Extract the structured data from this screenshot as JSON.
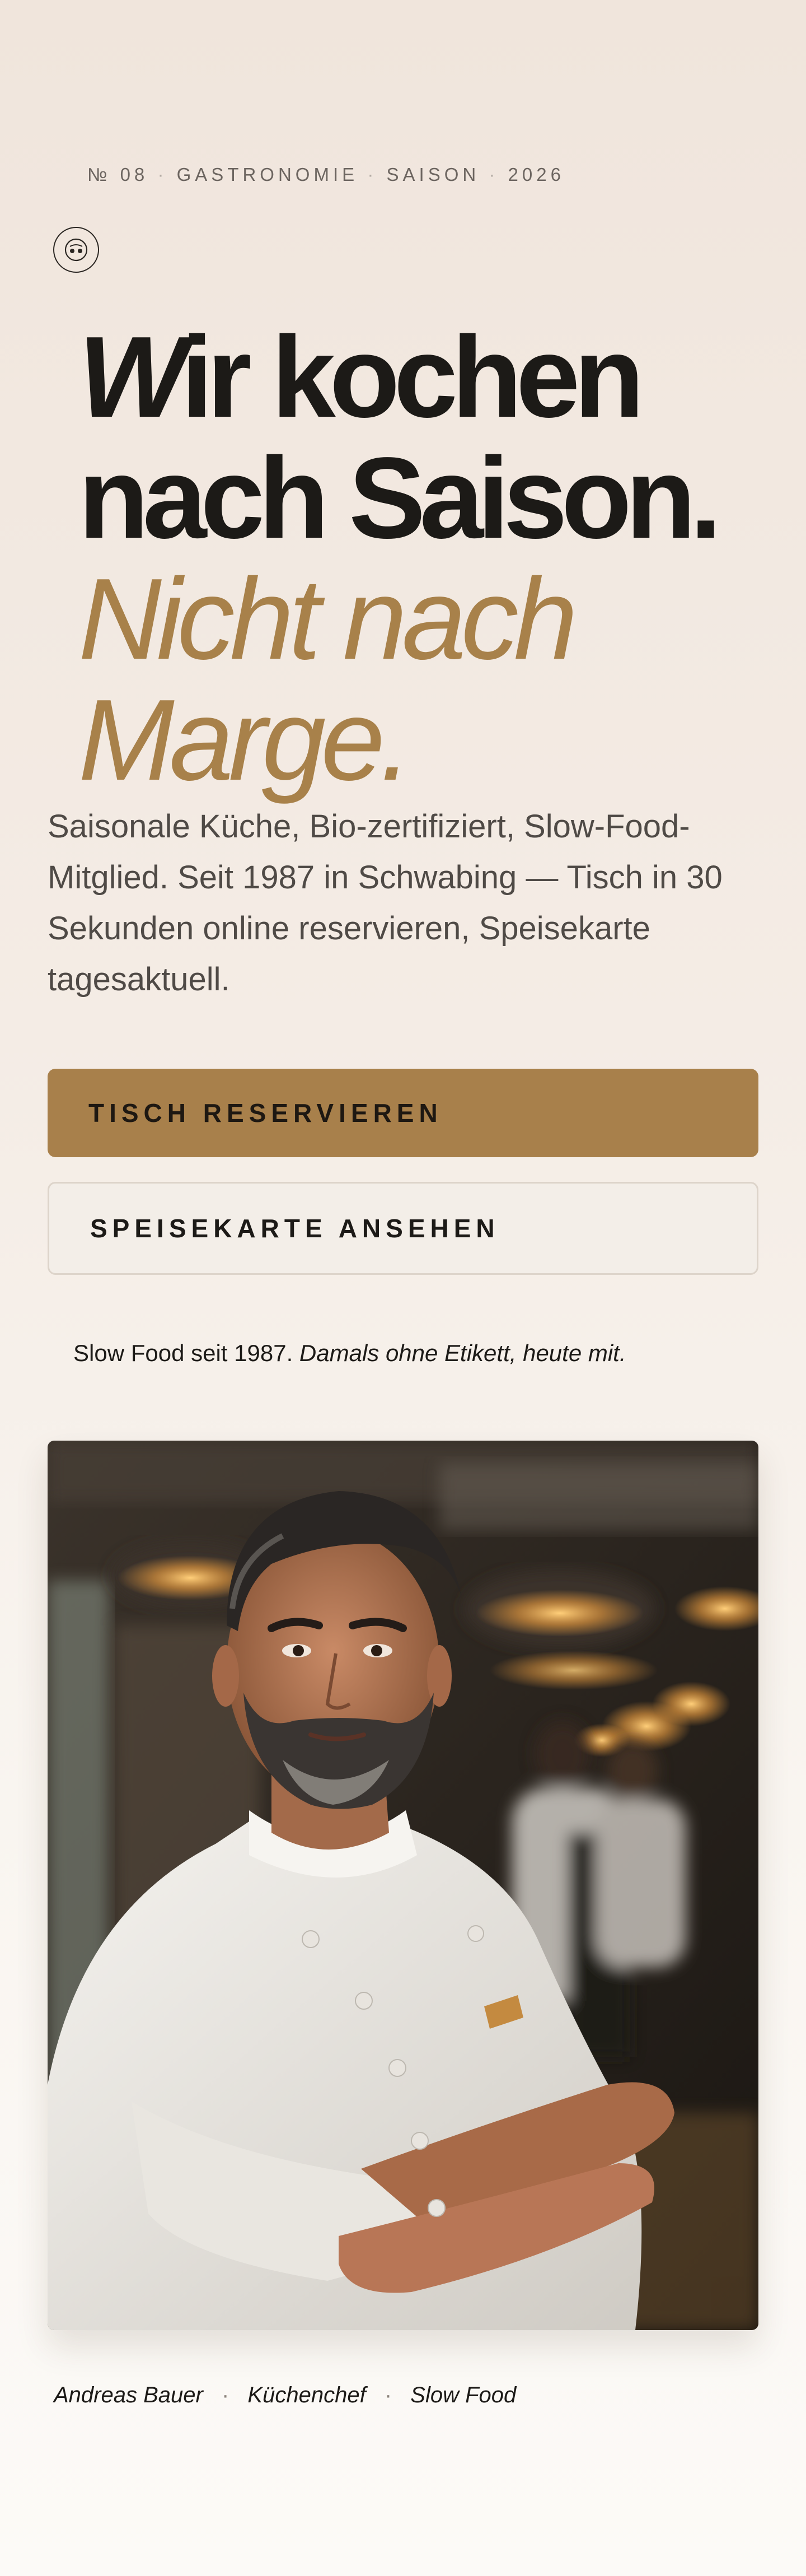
{
  "header": {
    "eyebrow": {
      "issue": "№ 08",
      "category": "GASTRONOMIE",
      "season": "SAISON",
      "year": "2026",
      "separator": "·"
    },
    "badge_icon": "chef-badge-icon"
  },
  "hero": {
    "headline_line1_w": "W",
    "headline_line1_rest": "ir kochen",
    "headline_line2": "nach Saison.",
    "headline_line3": "Nicht nach",
    "headline_line4": "Marge.",
    "lede": "Saisonale Küche, Bio-zertifiziert, Slow-Food-Mitglied. Seit 1987 in Schwabing — Tisch in 30 Sekunden online reservieren, Speisekarte tagesaktuell."
  },
  "actions": {
    "primary_label": "TISCH RESERVIEREN",
    "secondary_label": "SPEISEKARTE ANSEHEN"
  },
  "note": {
    "regular": "Slow Food seit 1987.",
    "italic": "Damals ohne Etikett, heute mit."
  },
  "photo": {
    "alt": "Portrait of the head chef in the kitchen"
  },
  "caption": {
    "name": "Andreas Bauer",
    "role": "Küchenchef",
    "tag": "Slow Food",
    "separator": "·"
  },
  "colors": {
    "accent": "#a8804b",
    "headline": "#1c1a17",
    "background_top": "#f0e5dc",
    "background_bottom": "#fcfaf7"
  }
}
